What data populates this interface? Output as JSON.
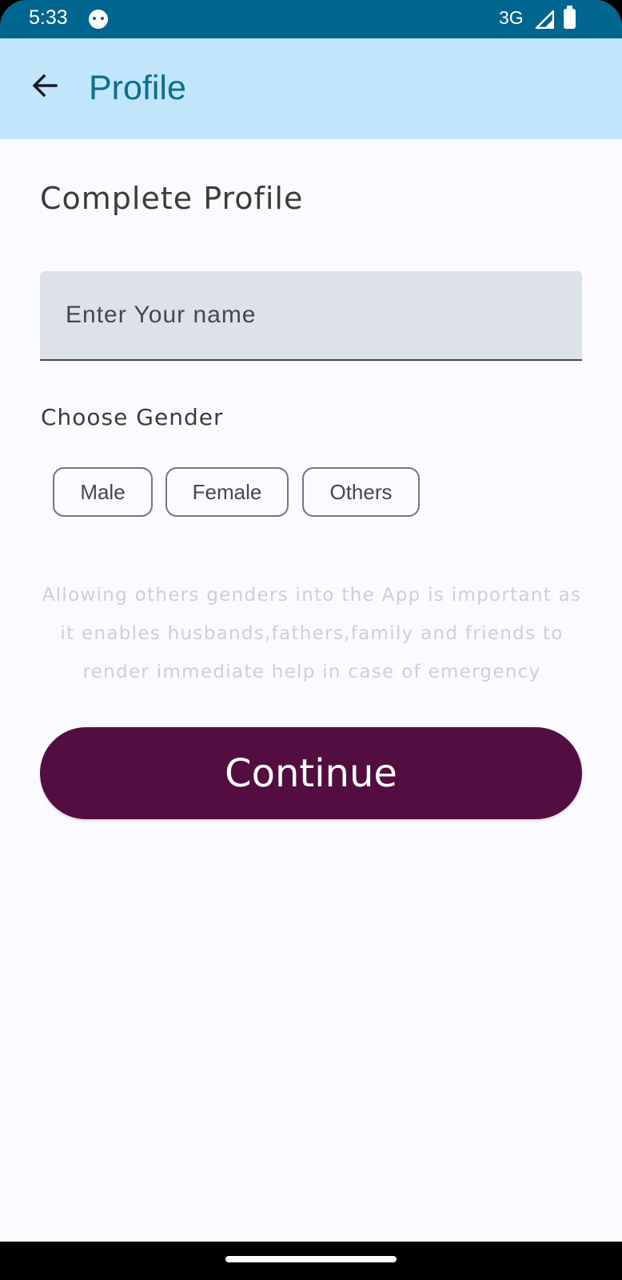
{
  "status_bar": {
    "time": "5:33",
    "network": "3G",
    "icons": [
      "app-notification-icon",
      "signal-icon",
      "battery-icon"
    ]
  },
  "app_bar": {
    "title": "Profile",
    "back_icon": "arrow-back-icon",
    "background_color": "#c1e6fc",
    "title_color": "#0e6e8d"
  },
  "form": {
    "heading": "Complete Profile",
    "name_input": {
      "placeholder": "Enter Your name",
      "value": ""
    },
    "gender_label": "Choose Gender",
    "gender_options": [
      "Male",
      "Female",
      "Others"
    ],
    "info_text": "Allowing others genders into the App is important as it enables husbands,fathers,family and friends to render immediate help in case of emergency",
    "continue_label": "Continue",
    "continue_color": "#540d40"
  }
}
